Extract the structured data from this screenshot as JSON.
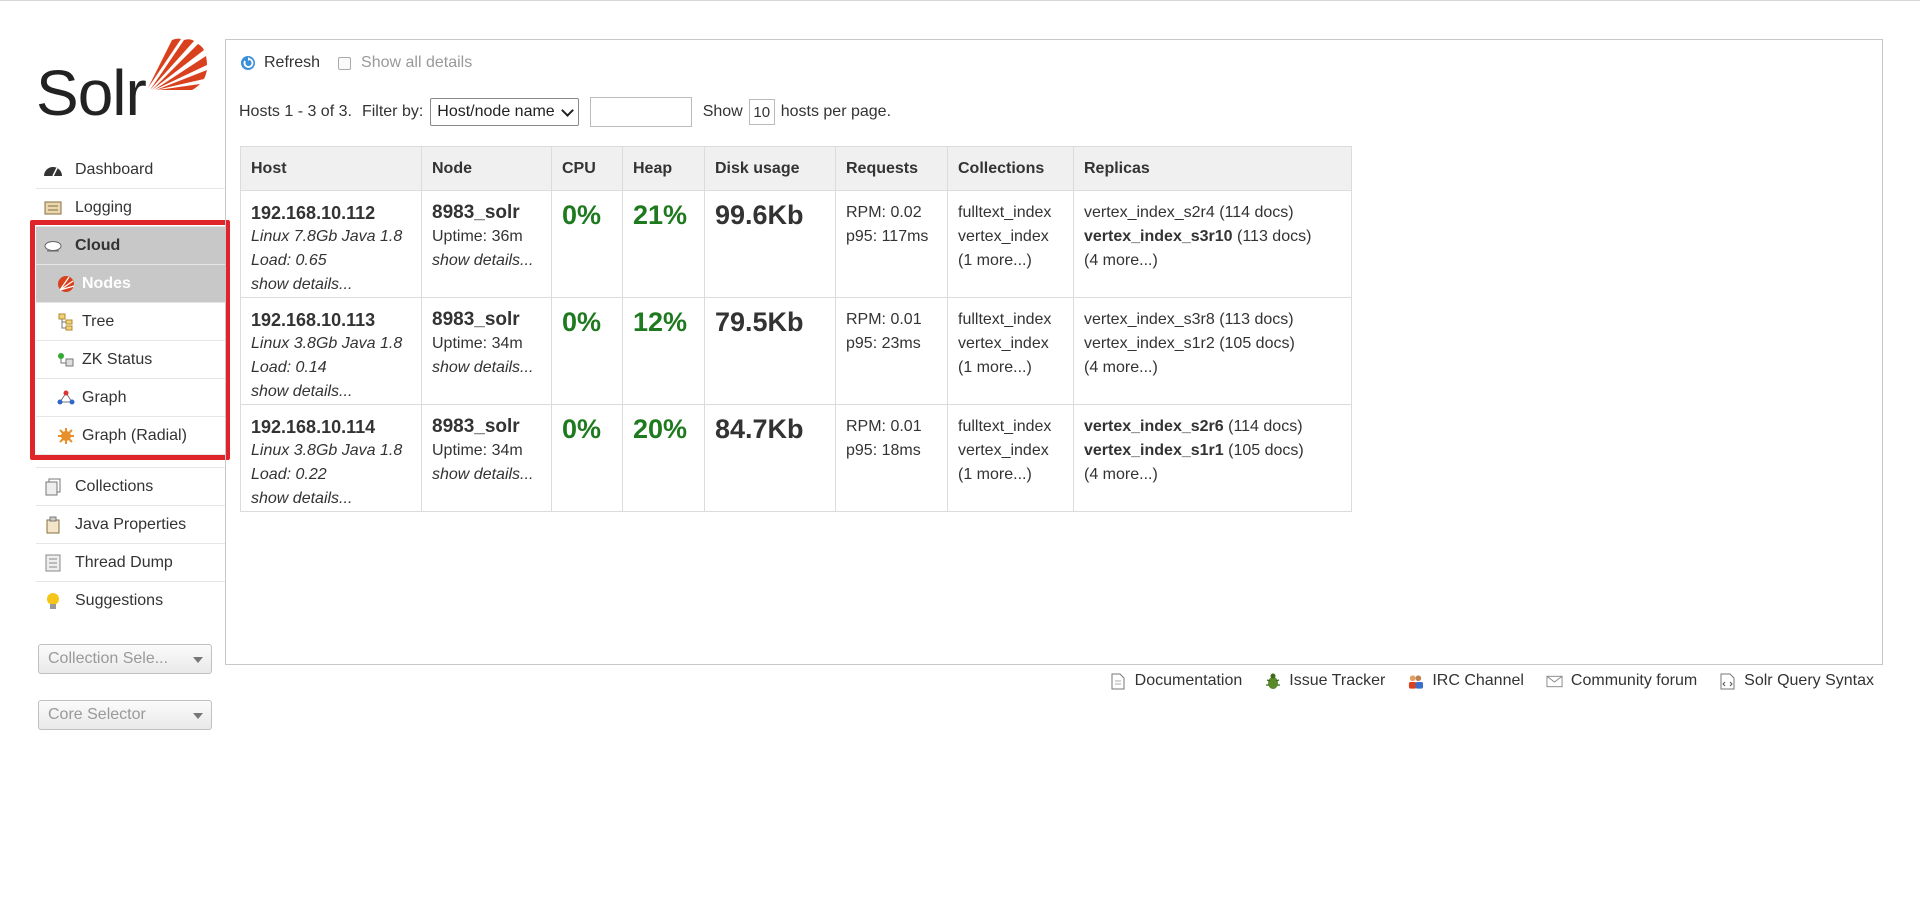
{
  "logo": {
    "text": "Solr"
  },
  "sidebar": {
    "items": [
      {
        "label": "Dashboard",
        "icon": "dashboard-icon"
      },
      {
        "label": "Logging",
        "icon": "logging-icon"
      },
      {
        "label": "Cloud",
        "icon": "cloud-icon"
      }
    ],
    "cloud_sub": [
      {
        "label": "Nodes",
        "icon": "solr-sun-icon"
      },
      {
        "label": "Tree",
        "icon": "tree-icon"
      },
      {
        "label": "ZK Status",
        "icon": "zk-status-icon"
      },
      {
        "label": "Graph",
        "icon": "graph-icon"
      },
      {
        "label": "Graph (Radial)",
        "icon": "graph-radial-icon"
      }
    ],
    "bottom_items": [
      {
        "label": "Collections",
        "icon": "collections-icon"
      },
      {
        "label": "Java Properties",
        "icon": "java-properties-icon"
      },
      {
        "label": "Thread Dump",
        "icon": "thread-dump-icon"
      },
      {
        "label": "Suggestions",
        "icon": "lightbulb-icon"
      }
    ],
    "collection_selector": "Collection Sele...",
    "core_selector": "Core Selector"
  },
  "toolbar": {
    "refresh": "Refresh",
    "show_all": "Show all details"
  },
  "filter": {
    "hosts_summary": "Hosts 1 - 3 of 3.",
    "filter_by": "Filter by:",
    "filter_option": "Host/node name",
    "show": "Show",
    "per_page": "10",
    "per_page_tail": "hosts per page."
  },
  "table": {
    "headers": [
      "Host",
      "Node",
      "CPU",
      "Heap",
      "Disk usage",
      "Requests",
      "Collections",
      "Replicas"
    ],
    "rows": [
      {
        "host": "192.168.10.112",
        "os": "Linux 7.8Gb Java 1.8",
        "load": "Load: 0.65",
        "host_details": "show details...",
        "node": "8983_solr",
        "uptime": "Uptime: 36m",
        "node_details": "show details...",
        "cpu": "0%",
        "heap": "21%",
        "disk": "99.6Kb",
        "rpm": "RPM: 0.02",
        "p95": "p95: 117ms",
        "collections": [
          "fulltext_index",
          "vertex_index",
          "(1 more...)"
        ],
        "replicas": [
          {
            "name": "vertex_index_s2r4",
            "docs": "(114 docs)",
            "bold": false
          },
          {
            "name": "vertex_index_s3r10",
            "docs": "(113 docs)",
            "bold": true
          }
        ],
        "replicas_more": "(4 more...)"
      },
      {
        "host": "192.168.10.113",
        "os": "Linux 3.8Gb Java 1.8",
        "load": "Load: 0.14",
        "host_details": "show details...",
        "node": "8983_solr",
        "uptime": "Uptime: 34m",
        "node_details": "show details...",
        "cpu": "0%",
        "heap": "12%",
        "disk": "79.5Kb",
        "rpm": "RPM: 0.01",
        "p95": "p95: 23ms",
        "collections": [
          "fulltext_index",
          "vertex_index",
          "(1 more...)"
        ],
        "replicas": [
          {
            "name": "vertex_index_s3r8",
            "docs": "(113 docs)",
            "bold": false
          },
          {
            "name": "vertex_index_s1r2",
            "docs": "(105 docs)",
            "bold": false
          }
        ],
        "replicas_more": "(4 more...)"
      },
      {
        "host": "192.168.10.114",
        "os": "Linux 3.8Gb Java 1.8",
        "load": "Load: 0.22",
        "host_details": "show details...",
        "node": "8983_solr",
        "uptime": "Uptime: 34m",
        "node_details": "show details...",
        "cpu": "0%",
        "heap": "20%",
        "disk": "84.7Kb",
        "rpm": "RPM: 0.01",
        "p95": "p95: 18ms",
        "collections": [
          "fulltext_index",
          "vertex_index",
          "(1 more...)"
        ],
        "replicas": [
          {
            "name": "vertex_index_s2r6",
            "docs": "(114 docs)",
            "bold": true
          },
          {
            "name": "vertex_index_s1r1",
            "docs": "(105 docs)",
            "bold": true
          }
        ],
        "replicas_more": "(4 more...)"
      }
    ]
  },
  "footer": {
    "links": [
      {
        "label": "Documentation",
        "icon": "document-icon"
      },
      {
        "label": "Issue Tracker",
        "icon": "bug-icon"
      },
      {
        "label": "IRC Channel",
        "icon": "irc-people-icon"
      },
      {
        "label": "Community forum",
        "icon": "mail-icon"
      },
      {
        "label": "Solr Query Syntax",
        "icon": "query-syntax-icon"
      }
    ]
  },
  "colors": {
    "accent_red": "#e0242b",
    "green": "#1f7a1f",
    "solr_orange": "#d9411e"
  }
}
